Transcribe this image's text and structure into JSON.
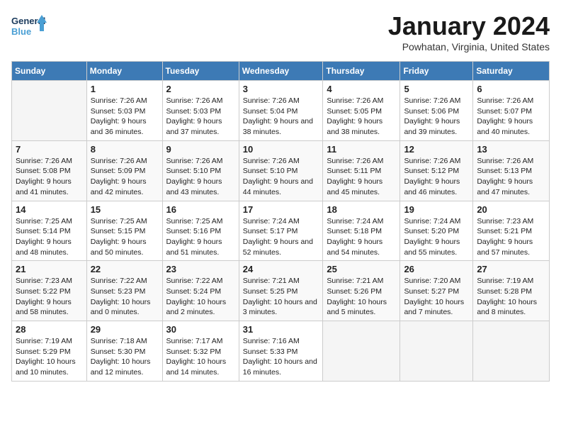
{
  "header": {
    "logo_line1": "General",
    "logo_line2": "Blue",
    "month": "January 2024",
    "location": "Powhatan, Virginia, United States"
  },
  "days_of_week": [
    "Sunday",
    "Monday",
    "Tuesday",
    "Wednesday",
    "Thursday",
    "Friday",
    "Saturday"
  ],
  "weeks": [
    [
      {
        "num": "",
        "empty": true
      },
      {
        "num": "1",
        "sunrise": "Sunrise: 7:26 AM",
        "sunset": "Sunset: 5:03 PM",
        "daylight": "Daylight: 9 hours and 36 minutes."
      },
      {
        "num": "2",
        "sunrise": "Sunrise: 7:26 AM",
        "sunset": "Sunset: 5:03 PM",
        "daylight": "Daylight: 9 hours and 37 minutes."
      },
      {
        "num": "3",
        "sunrise": "Sunrise: 7:26 AM",
        "sunset": "Sunset: 5:04 PM",
        "daylight": "Daylight: 9 hours and 38 minutes."
      },
      {
        "num": "4",
        "sunrise": "Sunrise: 7:26 AM",
        "sunset": "Sunset: 5:05 PM",
        "daylight": "Daylight: 9 hours and 38 minutes."
      },
      {
        "num": "5",
        "sunrise": "Sunrise: 7:26 AM",
        "sunset": "Sunset: 5:06 PM",
        "daylight": "Daylight: 9 hours and 39 minutes."
      },
      {
        "num": "6",
        "sunrise": "Sunrise: 7:26 AM",
        "sunset": "Sunset: 5:07 PM",
        "daylight": "Daylight: 9 hours and 40 minutes."
      }
    ],
    [
      {
        "num": "7",
        "sunrise": "Sunrise: 7:26 AM",
        "sunset": "Sunset: 5:08 PM",
        "daylight": "Daylight: 9 hours and 41 minutes."
      },
      {
        "num": "8",
        "sunrise": "Sunrise: 7:26 AM",
        "sunset": "Sunset: 5:09 PM",
        "daylight": "Daylight: 9 hours and 42 minutes."
      },
      {
        "num": "9",
        "sunrise": "Sunrise: 7:26 AM",
        "sunset": "Sunset: 5:10 PM",
        "daylight": "Daylight: 9 hours and 43 minutes."
      },
      {
        "num": "10",
        "sunrise": "Sunrise: 7:26 AM",
        "sunset": "Sunset: 5:10 PM",
        "daylight": "Daylight: 9 hours and 44 minutes."
      },
      {
        "num": "11",
        "sunrise": "Sunrise: 7:26 AM",
        "sunset": "Sunset: 5:11 PM",
        "daylight": "Daylight: 9 hours and 45 minutes."
      },
      {
        "num": "12",
        "sunrise": "Sunrise: 7:26 AM",
        "sunset": "Sunset: 5:12 PM",
        "daylight": "Daylight: 9 hours and 46 minutes."
      },
      {
        "num": "13",
        "sunrise": "Sunrise: 7:26 AM",
        "sunset": "Sunset: 5:13 PM",
        "daylight": "Daylight: 9 hours and 47 minutes."
      }
    ],
    [
      {
        "num": "14",
        "sunrise": "Sunrise: 7:25 AM",
        "sunset": "Sunset: 5:14 PM",
        "daylight": "Daylight: 9 hours and 48 minutes."
      },
      {
        "num": "15",
        "sunrise": "Sunrise: 7:25 AM",
        "sunset": "Sunset: 5:15 PM",
        "daylight": "Daylight: 9 hours and 50 minutes."
      },
      {
        "num": "16",
        "sunrise": "Sunrise: 7:25 AM",
        "sunset": "Sunset: 5:16 PM",
        "daylight": "Daylight: 9 hours and 51 minutes."
      },
      {
        "num": "17",
        "sunrise": "Sunrise: 7:24 AM",
        "sunset": "Sunset: 5:17 PM",
        "daylight": "Daylight: 9 hours and 52 minutes."
      },
      {
        "num": "18",
        "sunrise": "Sunrise: 7:24 AM",
        "sunset": "Sunset: 5:18 PM",
        "daylight": "Daylight: 9 hours and 54 minutes."
      },
      {
        "num": "19",
        "sunrise": "Sunrise: 7:24 AM",
        "sunset": "Sunset: 5:20 PM",
        "daylight": "Daylight: 9 hours and 55 minutes."
      },
      {
        "num": "20",
        "sunrise": "Sunrise: 7:23 AM",
        "sunset": "Sunset: 5:21 PM",
        "daylight": "Daylight: 9 hours and 57 minutes."
      }
    ],
    [
      {
        "num": "21",
        "sunrise": "Sunrise: 7:23 AM",
        "sunset": "Sunset: 5:22 PM",
        "daylight": "Daylight: 9 hours and 58 minutes."
      },
      {
        "num": "22",
        "sunrise": "Sunrise: 7:22 AM",
        "sunset": "Sunset: 5:23 PM",
        "daylight": "Daylight: 10 hours and 0 minutes."
      },
      {
        "num": "23",
        "sunrise": "Sunrise: 7:22 AM",
        "sunset": "Sunset: 5:24 PM",
        "daylight": "Daylight: 10 hours and 2 minutes."
      },
      {
        "num": "24",
        "sunrise": "Sunrise: 7:21 AM",
        "sunset": "Sunset: 5:25 PM",
        "daylight": "Daylight: 10 hours and 3 minutes."
      },
      {
        "num": "25",
        "sunrise": "Sunrise: 7:21 AM",
        "sunset": "Sunset: 5:26 PM",
        "daylight": "Daylight: 10 hours and 5 minutes."
      },
      {
        "num": "26",
        "sunrise": "Sunrise: 7:20 AM",
        "sunset": "Sunset: 5:27 PM",
        "daylight": "Daylight: 10 hours and 7 minutes."
      },
      {
        "num": "27",
        "sunrise": "Sunrise: 7:19 AM",
        "sunset": "Sunset: 5:28 PM",
        "daylight": "Daylight: 10 hours and 8 minutes."
      }
    ],
    [
      {
        "num": "28",
        "sunrise": "Sunrise: 7:19 AM",
        "sunset": "Sunset: 5:29 PM",
        "daylight": "Daylight: 10 hours and 10 minutes."
      },
      {
        "num": "29",
        "sunrise": "Sunrise: 7:18 AM",
        "sunset": "Sunset: 5:30 PM",
        "daylight": "Daylight: 10 hours and 12 minutes."
      },
      {
        "num": "30",
        "sunrise": "Sunrise: 7:17 AM",
        "sunset": "Sunset: 5:32 PM",
        "daylight": "Daylight: 10 hours and 14 minutes."
      },
      {
        "num": "31",
        "sunrise": "Sunrise: 7:16 AM",
        "sunset": "Sunset: 5:33 PM",
        "daylight": "Daylight: 10 hours and 16 minutes."
      },
      {
        "num": "",
        "empty": true
      },
      {
        "num": "",
        "empty": true
      },
      {
        "num": "",
        "empty": true
      }
    ]
  ]
}
